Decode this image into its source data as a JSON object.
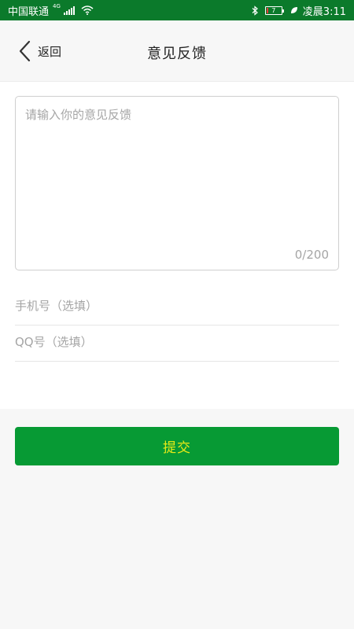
{
  "status_bar": {
    "carrier": "中国联通",
    "network": "4G",
    "battery": "7",
    "time": "凌晨3:11"
  },
  "header": {
    "back_label": "返回",
    "title": "意见反馈"
  },
  "form": {
    "feedback_placeholder": "请输入你的意见反馈",
    "char_count": "0/200",
    "phone_placeholder": "手机号（选填）",
    "qq_placeholder": "QQ号（选填）"
  },
  "submit": {
    "label": "提交"
  },
  "colors": {
    "status_bar": "#0b7a2b",
    "submit_bg": "#079a34",
    "submit_text": "#e7ea17"
  }
}
